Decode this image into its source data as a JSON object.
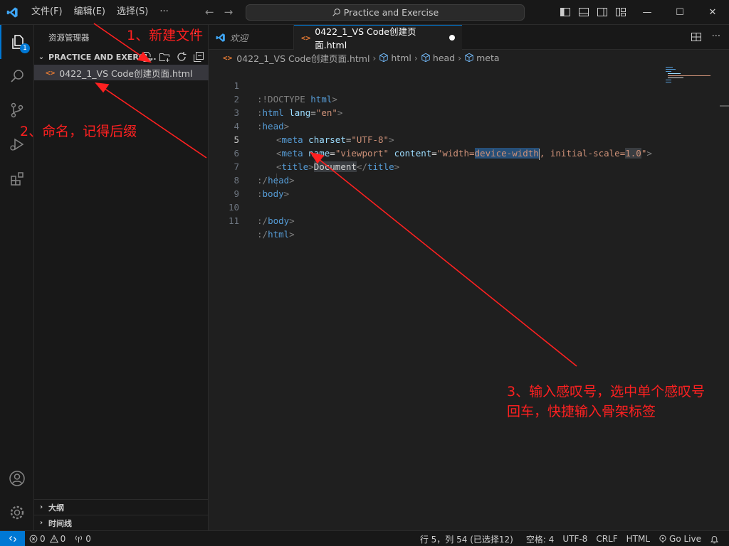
{
  "titlebar": {
    "menu": [
      "文件(F)",
      "编辑(E)",
      "选择(S)",
      "···"
    ],
    "command_center": "Practice and Exercise"
  },
  "activitybar": {
    "explorer_badge": "1"
  },
  "sidebar": {
    "title": "资源管理器",
    "more": "···",
    "folder_name": "PRACTICE AND EXERCI...",
    "file_name": "0422_1_VS Code创建页面.html",
    "sections": [
      "大纲",
      "时间线"
    ]
  },
  "tabs": [
    {
      "label": "欢迎",
      "active": false
    },
    {
      "label": "0422_1_VS Code创建页面.html",
      "active": true,
      "dirty": true
    }
  ],
  "breadcrumbs": [
    "0422_1_VS Code创建页面.html",
    "html",
    "head",
    "meta"
  ],
  "editor": {
    "line_numbers": [
      "1",
      "2",
      "3",
      "4",
      "5",
      "6",
      "7",
      "8",
      "9",
      "10",
      "11"
    ],
    "current_line": "5",
    "code_text": {
      "l1_a": ":!DOCTYPE ",
      "l1_b": "html",
      "l1_c": ">",
      "l2_a": ":",
      "l2_b": "html ",
      "l2_c": "lang",
      "l2_d": "=",
      "l2_e": "\"en\"",
      "l2_f": ">",
      "l3_a": ":",
      "l3_b": "head",
      "l3_c": ">",
      "l4_a": "<",
      "l4_b": "meta ",
      "l4_c": "charset",
      "l4_d": "=",
      "l4_e": "\"UTF-8\"",
      "l4_f": ">",
      "l5_a": "<",
      "l5_b": "meta ",
      "l5_c": "name",
      "l5_d": "=",
      "l5_e": "\"viewport\"",
      "l5_f": " content",
      "l5_g": "=",
      "l5_h": "\"width=",
      "l5_i": "device-width",
      "l5_j": ", initial-scale=",
      "l5_k": "1.0",
      "l5_l": "\"",
      "l5_m": ">",
      "l6_a": "<",
      "l6_b": "title",
      "l6_c": ">",
      "l6_d": "Document",
      "l6_e": "</",
      "l6_f": "title",
      "l6_g": ">",
      "l7_a": ":/",
      "l7_b": "head",
      "l7_c": ">",
      "l8_a": ":",
      "l8_b": "body",
      "l8_c": ">",
      "l10_a": ":/",
      "l10_b": "body",
      "l10_c": ">",
      "l11_a": ":/",
      "l11_b": "html",
      "l11_c": ">"
    }
  },
  "annotations": {
    "a1": "1、新建文件",
    "a2": "2、命名，记得后缀",
    "a3_line1": "3、输入感叹号，选中单个感叹号",
    "a3_line2": "回车，快捷输入骨架标签",
    "color": "#ff2020"
  },
  "statusbar": {
    "errors": "0",
    "warnings": "0",
    "ports": "0",
    "position": "行 5，列 54 (已选择12)",
    "spaces": "空格: 4",
    "encoding": "UTF-8",
    "eol": "CRLF",
    "language": "HTML",
    "golive": "Go Live"
  }
}
